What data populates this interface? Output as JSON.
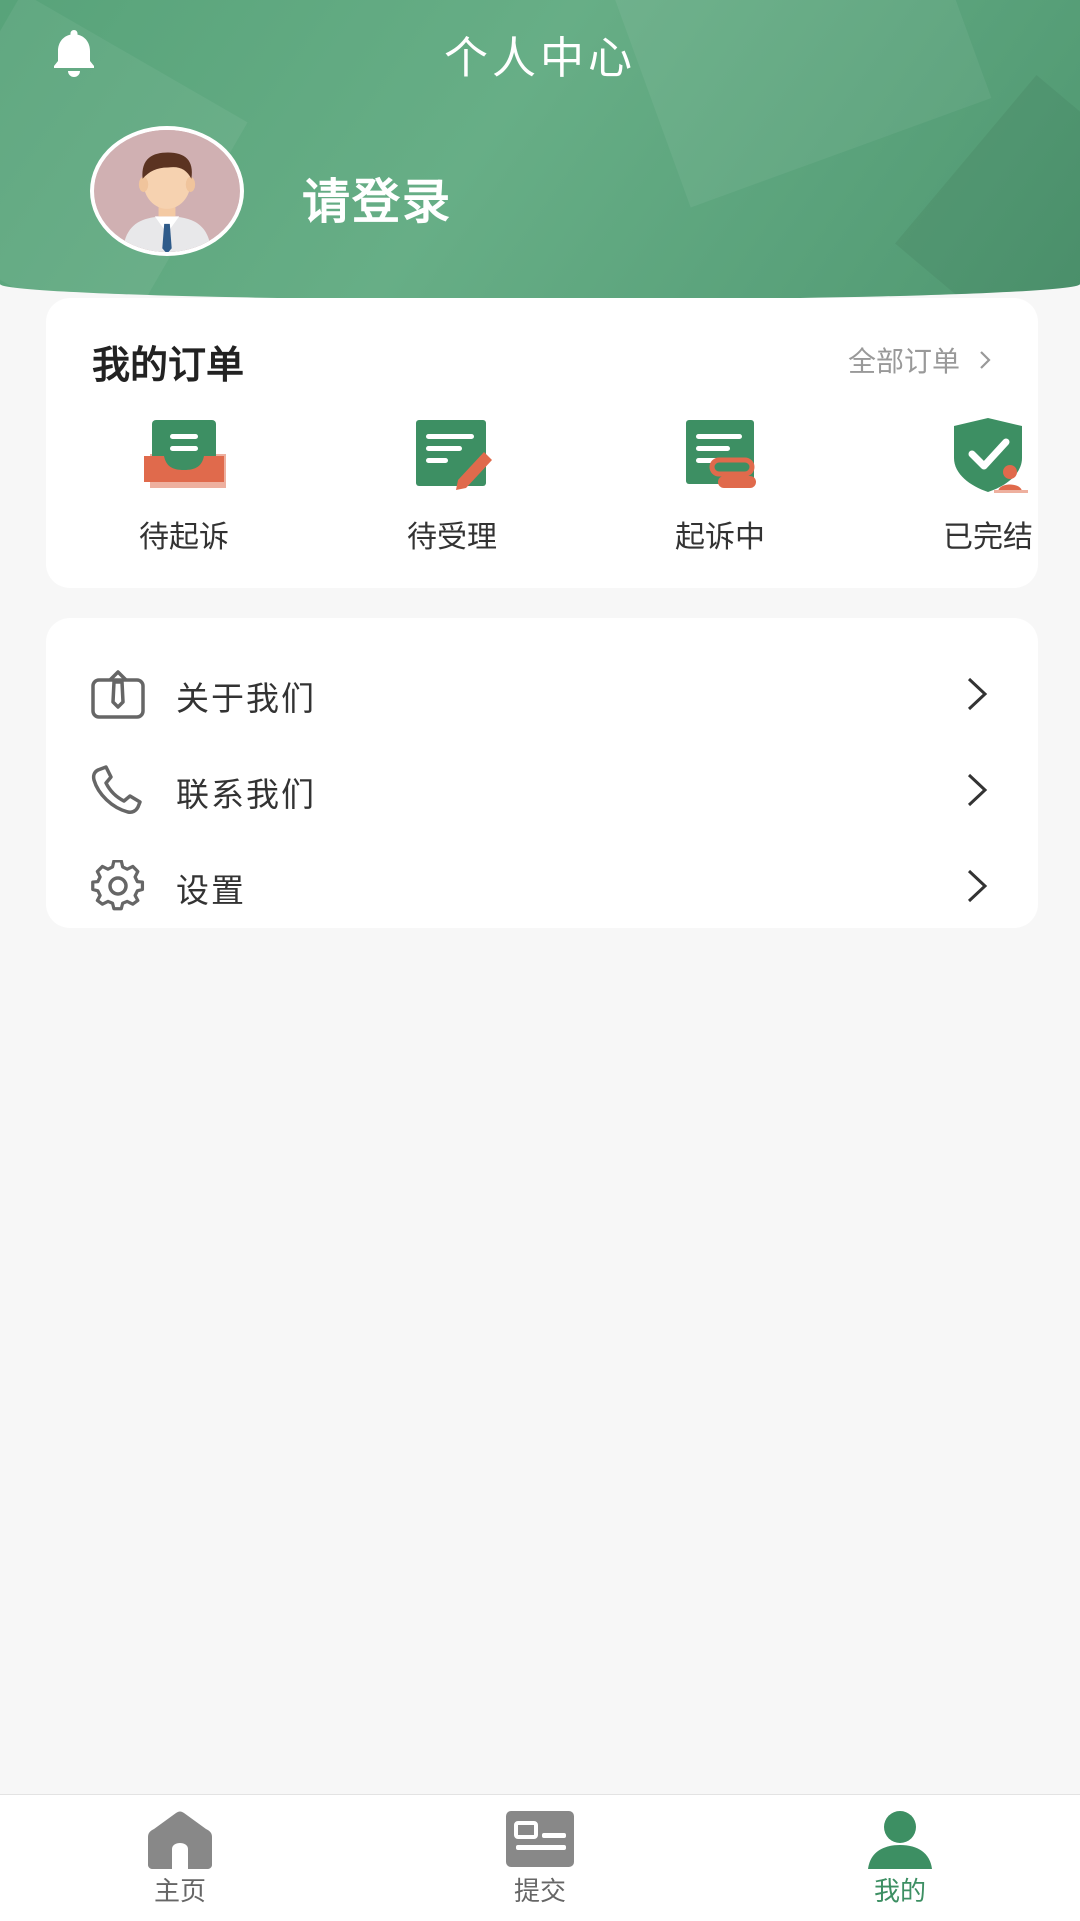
{
  "header": {
    "title": "个人中心",
    "login_text": "请登录"
  },
  "orders": {
    "title": "我的订单",
    "all_orders_label": "全部订单",
    "items": [
      {
        "label": "待起诉",
        "icon": "pending-suit-icon"
      },
      {
        "label": "待受理",
        "icon": "pending-accept-icon"
      },
      {
        "label": "起诉中",
        "icon": "in-suit-icon"
      },
      {
        "label": "已完结",
        "icon": "completed-icon"
      }
    ]
  },
  "menu": {
    "items": [
      {
        "label": "关于我们",
        "icon": "about-icon"
      },
      {
        "label": "联系我们",
        "icon": "phone-icon"
      },
      {
        "label": "设置",
        "icon": "gear-icon"
      }
    ]
  },
  "tabbar": {
    "items": [
      {
        "label": "主页",
        "icon": "home-icon",
        "active": false
      },
      {
        "label": "提交",
        "icon": "submit-icon",
        "active": false
      },
      {
        "label": "我的",
        "icon": "user-icon",
        "active": true
      }
    ]
  },
  "colors": {
    "brand_green": "#5ba67d",
    "icon_green": "#3d8f63",
    "accent_orange": "#e06a4c",
    "background": "#f7f7f7"
  }
}
